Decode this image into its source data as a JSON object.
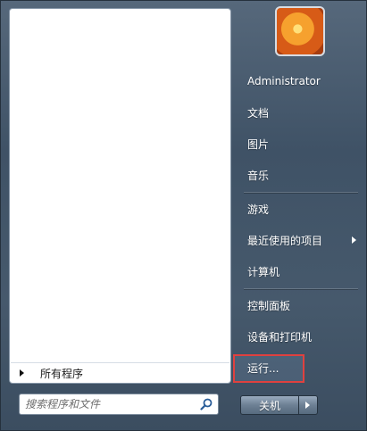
{
  "user": {
    "name": "Administrator"
  },
  "right_menu": {
    "documents": "文档",
    "pictures": "图片",
    "music": "音乐",
    "games": "游戏",
    "recent_items": "最近使用的项目",
    "computer": "计算机",
    "control_panel": "控制面板",
    "devices_printers": "设备和打印机",
    "run": "运行..."
  },
  "left_menu": {
    "all_programs": "所有程序"
  },
  "search": {
    "placeholder": "搜索程序和文件"
  },
  "shutdown": {
    "label": "关机"
  },
  "colors": {
    "highlight_border": "#e0413f",
    "panel": "#46596c"
  },
  "icons": {
    "search": "search-icon",
    "submenu": "chevron-right-icon",
    "avatar": "user-picture-flower"
  }
}
